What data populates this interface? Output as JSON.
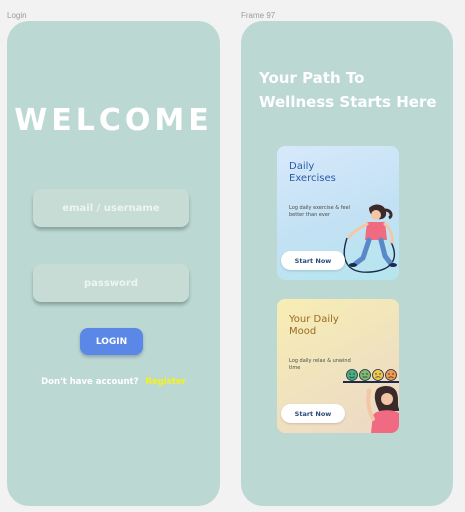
{
  "frames": {
    "login_label": "Login",
    "welcome_label": "Frame 97"
  },
  "login": {
    "title": "WELCOME",
    "email_placeholder": "email / username",
    "password_placeholder": "password",
    "login_button": "LOGIN",
    "signup_question": "Don't have account?",
    "signup_link": "Register"
  },
  "welcome": {
    "tagline_line1": "Your Path To",
    "tagline_line2": "Wellness Starts Here",
    "cards": [
      {
        "title_line1": "Daily",
        "title_line2": "Exercises",
        "desc": "Log daily exercise & feel better than ever",
        "button": "Start Now",
        "illustration": "person-jumping-rope"
      },
      {
        "title_line1": "Your Daily",
        "title_line2": "Mood",
        "desc": "Log daily relax & unwind time",
        "button": "Start Now",
        "illustration": "person-rating-mood-faces"
      }
    ]
  },
  "colors": {
    "frame_bg": "#bcd8d3",
    "canvas_bg": "#f2f2f2",
    "login_button": "#5b88e6",
    "register_link": "#f6f21c"
  }
}
